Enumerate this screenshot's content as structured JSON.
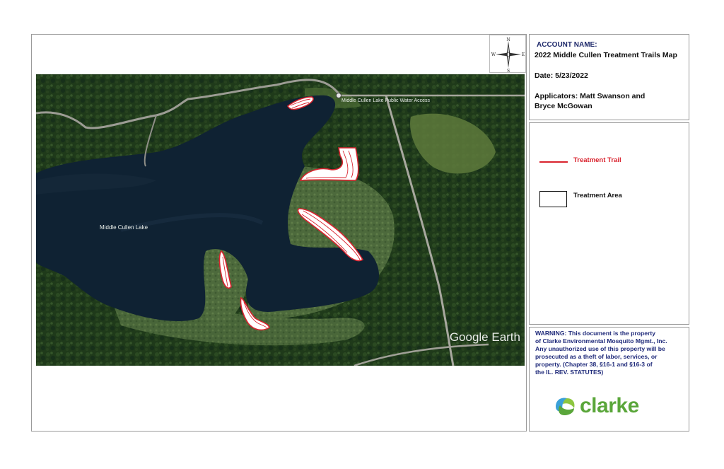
{
  "header": {
    "account_label": "ACCOUNT NAME:",
    "map_title": "2022 Middle Cullen Treatment Trails Map",
    "date": "Date: 5/23/2022",
    "applicators_line1": "Applicators: Matt Swanson and",
    "applicators_line2": "Bryce McGowan"
  },
  "compass": {
    "north": "N",
    "south": "S",
    "east": "E",
    "west": "W"
  },
  "legend": {
    "trail_label": "Treatment Trail",
    "area_label": "Treatment Area",
    "trail_color": "#d9232e"
  },
  "warning": {
    "lines": [
      "WARNING:  This document is the property",
      "of Clarke Environmental Mosquito Mgmt., Inc.",
      "Any unauthorized use of this property will be",
      "prosecuted as a theft of labor, services, or",
      "property.  (Chapter 38, §16-1 and §16-3 of",
      "the IL. REV. STATUTES)"
    ]
  },
  "logo": {
    "text": "clarke",
    "green": "#5aa63a",
    "blue": "#3aa0d8"
  },
  "map": {
    "lake_name": "Middle Cullen Lake",
    "access_label": "Middle Cullen Lake Public Water Access",
    "attribution": "Google Earth"
  }
}
